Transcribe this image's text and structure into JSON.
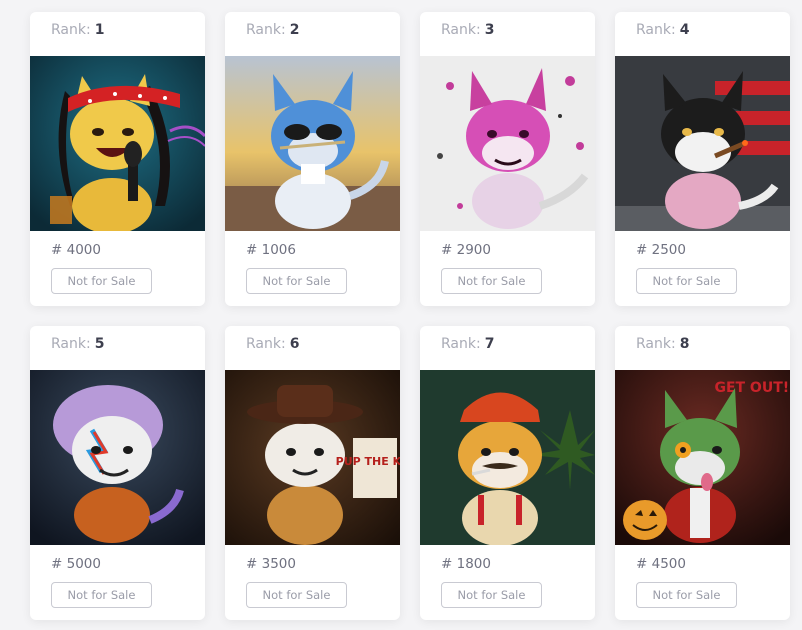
{
  "rank_label": "Rank:",
  "status_label": "Not for Sale",
  "cards": [
    {
      "rank": "1",
      "number": "# 4000"
    },
    {
      "rank": "2",
      "number": "# 1006"
    },
    {
      "rank": "3",
      "number": "# 2900"
    },
    {
      "rank": "4",
      "number": "# 2500"
    },
    {
      "rank": "5",
      "number": "# 5000"
    },
    {
      "rank": "6",
      "number": "# 3500"
    },
    {
      "rank": "7",
      "number": "# 1800"
    },
    {
      "rank": "8",
      "number": "# 4500"
    }
  ],
  "art_text": {
    "card6_sign": "PUP THE KID",
    "card8_sign": "GET OUT!!"
  }
}
